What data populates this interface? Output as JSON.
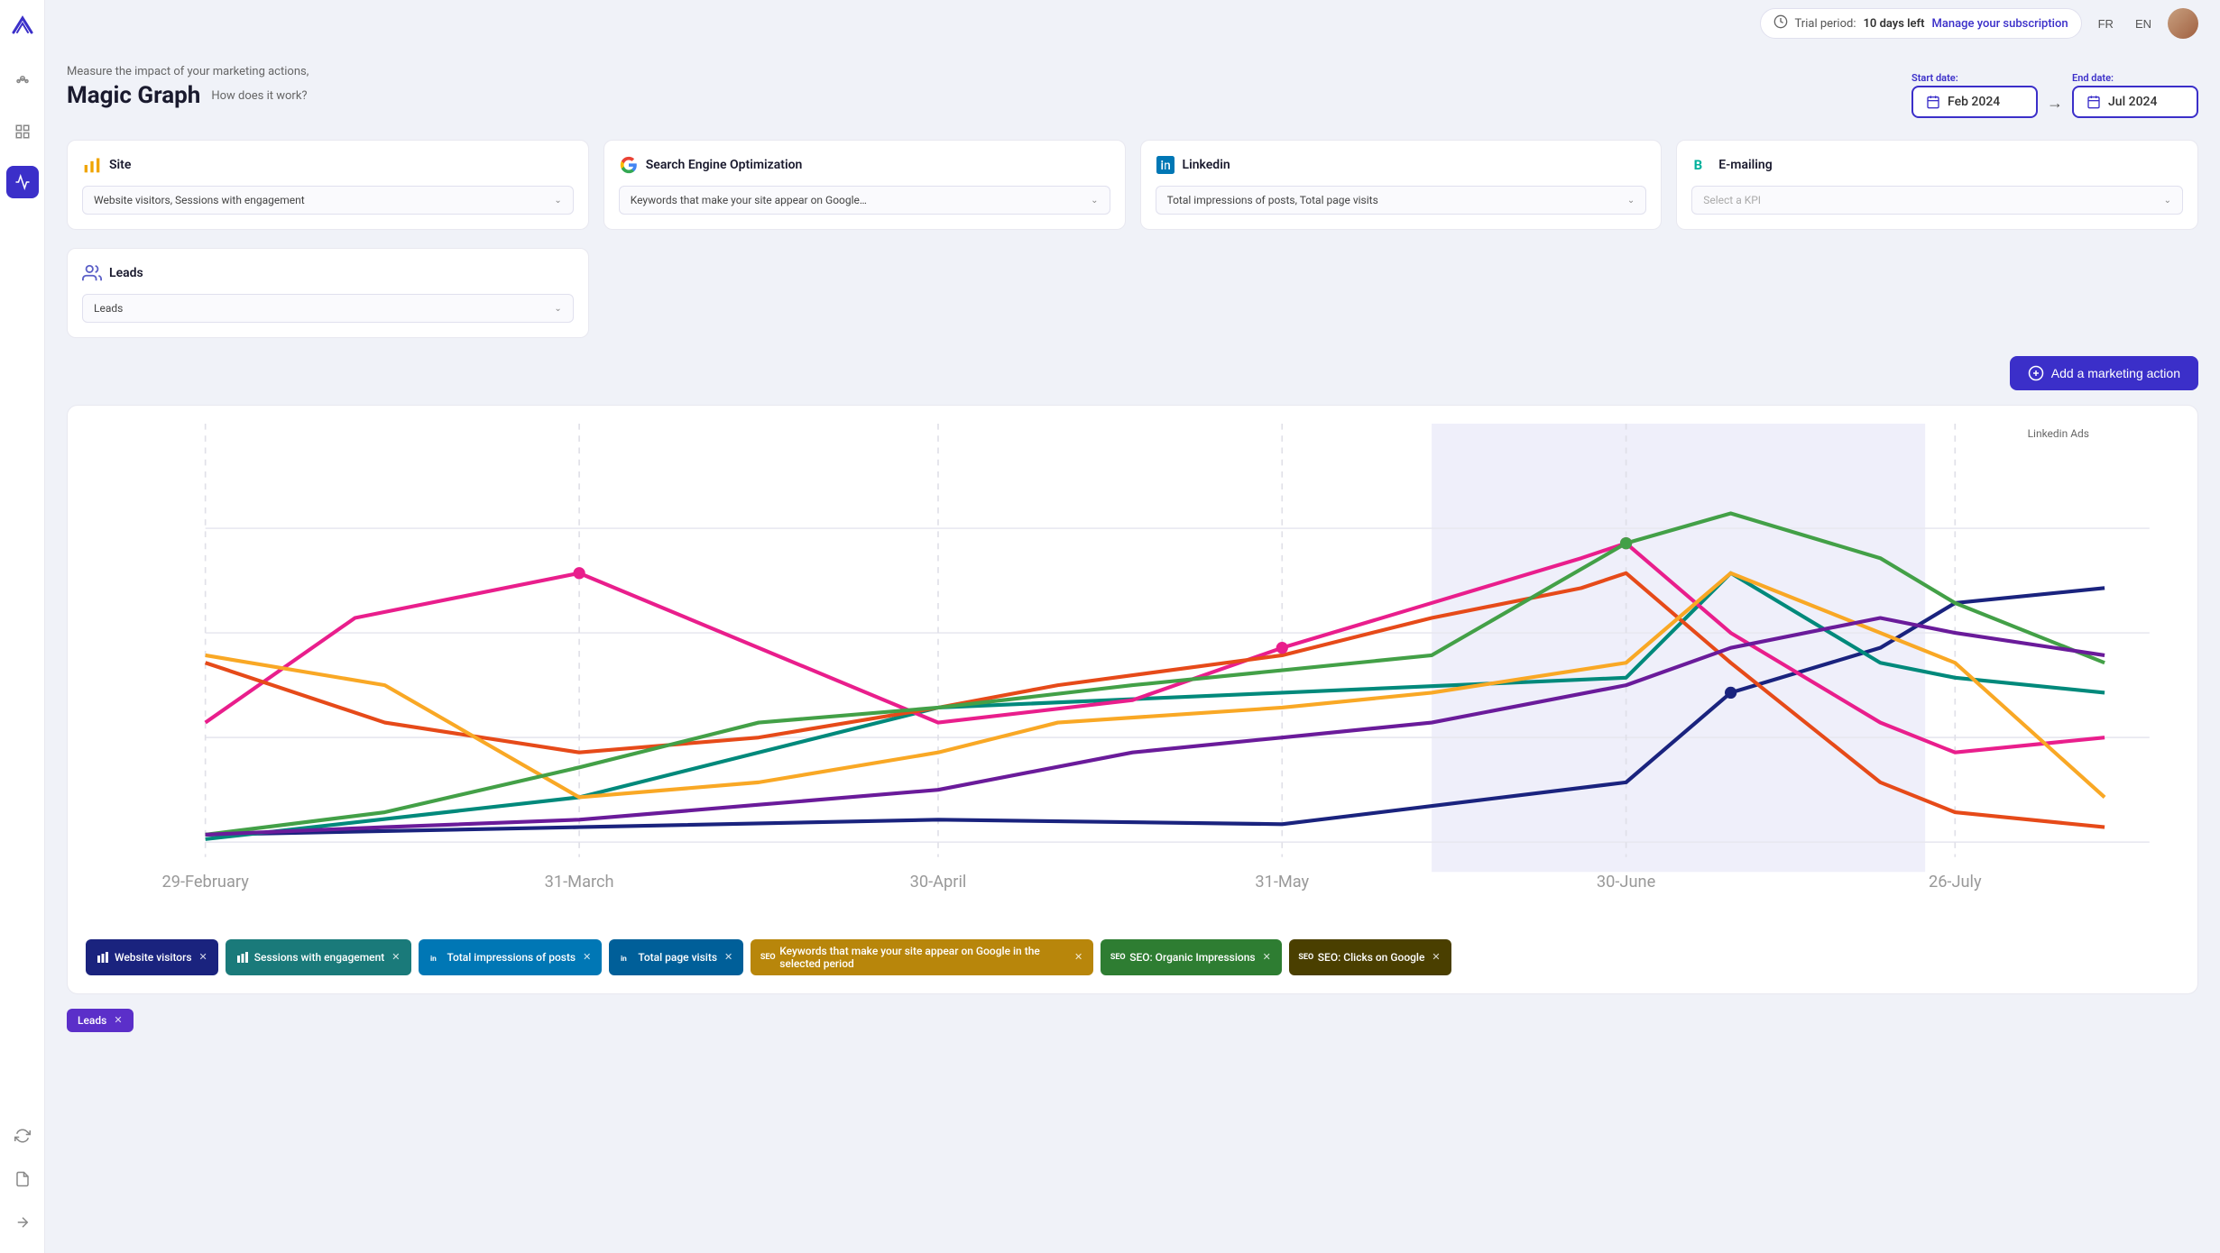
{
  "topbar": {
    "trial_label": "Trial period:",
    "trial_days": "10 days left",
    "manage_link": "Manage your subscription",
    "lang_fr": "FR",
    "lang_en": "EN"
  },
  "page": {
    "subtitle": "Measure the impact of your marketing actions,",
    "title": "Magic Graph",
    "how_it_works": "How does it work?"
  },
  "date_range": {
    "start_label": "Start date:",
    "start_value": "Feb 2024",
    "end_label": "End date:",
    "end_value": "Jul 2024"
  },
  "kpi_cards": [
    {
      "id": "site",
      "title": "Site",
      "icon_type": "bar-chart",
      "icon_color": "#f0a500",
      "selected": "Website visitors, Sessions with engagement"
    },
    {
      "id": "seo",
      "title": "Search Engine Optimization",
      "icon_type": "google",
      "icon_color": "#4285f4",
      "selected": "Keywords that make your site appear on Google…"
    },
    {
      "id": "linkedin",
      "title": "Linkedin",
      "icon_type": "linkedin",
      "icon_color": "#0077b5",
      "selected": "Total impressions of posts, Total page visits"
    },
    {
      "id": "emailing",
      "title": "E-mailing",
      "icon_type": "brevo",
      "icon_color": "#00b09b",
      "selected": "Select a KPI"
    }
  ],
  "leads_card": {
    "title": "Leads",
    "icon_type": "users",
    "selected": "Leads"
  },
  "add_action_btn": "Add a marketing action",
  "chart": {
    "x_labels": [
      "29-February",
      "31-March",
      "30-April",
      "31-May",
      "30-June",
      "26-July"
    ],
    "highlighted_region_label": "Linkedin Ads"
  },
  "legend_chips": [
    {
      "label": "Website visitors",
      "color_class": "dark-blue",
      "icon": "bar"
    },
    {
      "label": "Sessions with engagement",
      "color_class": "teal",
      "icon": "bar"
    },
    {
      "label": "Total impressions of posts",
      "color_class": "linkedin-blue",
      "icon": "linkedin"
    },
    {
      "label": "Total page visits",
      "color_class": "linkedin-blue2",
      "icon": "linkedin"
    },
    {
      "label": "Keywords that make your site appear on Google in the selected period",
      "color_class": "seo-yellow",
      "icon": "seo"
    },
    {
      "label": "SEO: Organic Impressions",
      "color_class": "seo-green",
      "icon": "seo"
    },
    {
      "label": "SEO: Clicks on Google",
      "color_class": "seo-dark",
      "icon": "seo"
    }
  ],
  "sidebar": {
    "nav_items": [
      {
        "id": "home",
        "icon": "home"
      },
      {
        "id": "grid",
        "icon": "grid"
      },
      {
        "id": "chart",
        "icon": "chart",
        "active": true
      }
    ],
    "bottom_items": [
      {
        "id": "refresh",
        "icon": "refresh"
      },
      {
        "id": "document",
        "icon": "document"
      },
      {
        "id": "arrow-right",
        "icon": "arrow-right"
      }
    ]
  }
}
